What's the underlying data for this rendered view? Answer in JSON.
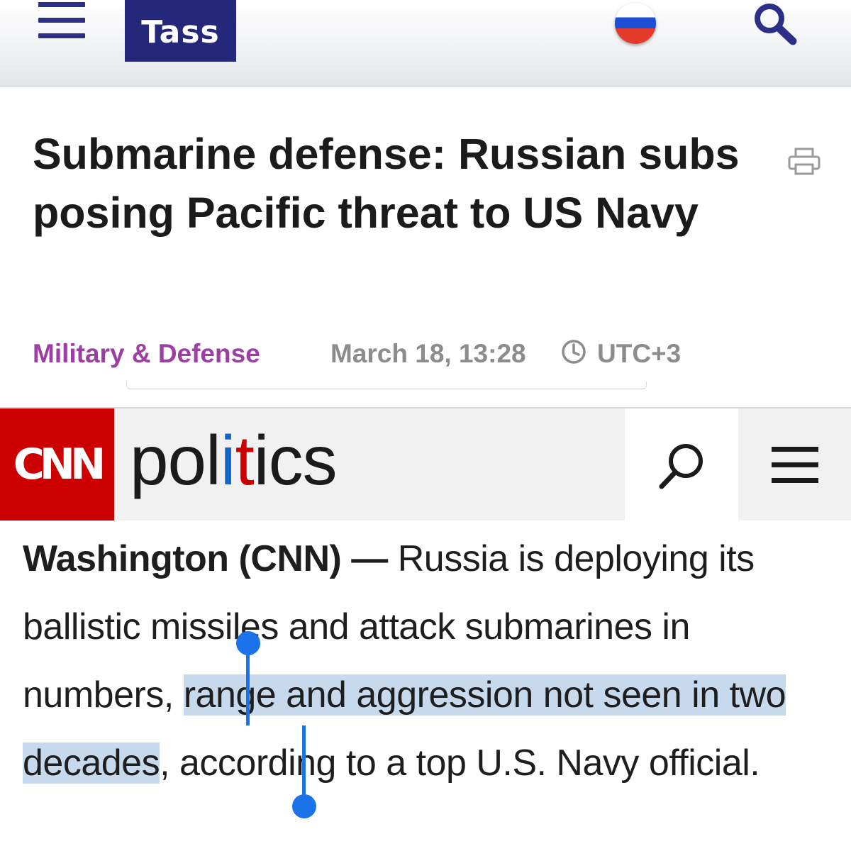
{
  "tass": {
    "logo_text": "Tass",
    "menu_icon": "hamburger-menu-icon",
    "language_icon": "russian-flag-icon",
    "search_icon": "magnifier-icon",
    "accent_color": "#25277a",
    "article": {
      "title": "Submarine defense: Russian subs posing Pacific threat to US Navy",
      "category": "Military & Defense",
      "category_color": "#9b3fa3",
      "date": "March 18, 13:28",
      "timezone": "UTC+3"
    },
    "print_icon": "printer-icon",
    "clock_icon": "clock-icon"
  },
  "cnn": {
    "logo_text": "CNN",
    "logo_color": "#cc0000",
    "section": {
      "part1": "pol",
      "part2": "i",
      "part3": "t",
      "part4": "ics"
    },
    "search_icon": "magnifier-icon",
    "menu_icon": "hamburger-menu-icon",
    "article": {
      "dateline": "Washington (CNN)",
      "dash": " — ",
      "text_before_selection": "Russia is deploying its ballistic missiles and attack submarines in numbers, ",
      "selected_text": "range and aggression not seen in two decades",
      "text_after_selection": ", according to a top U.S. Navy official.",
      "selection_color": "#c7d9ec"
    }
  }
}
